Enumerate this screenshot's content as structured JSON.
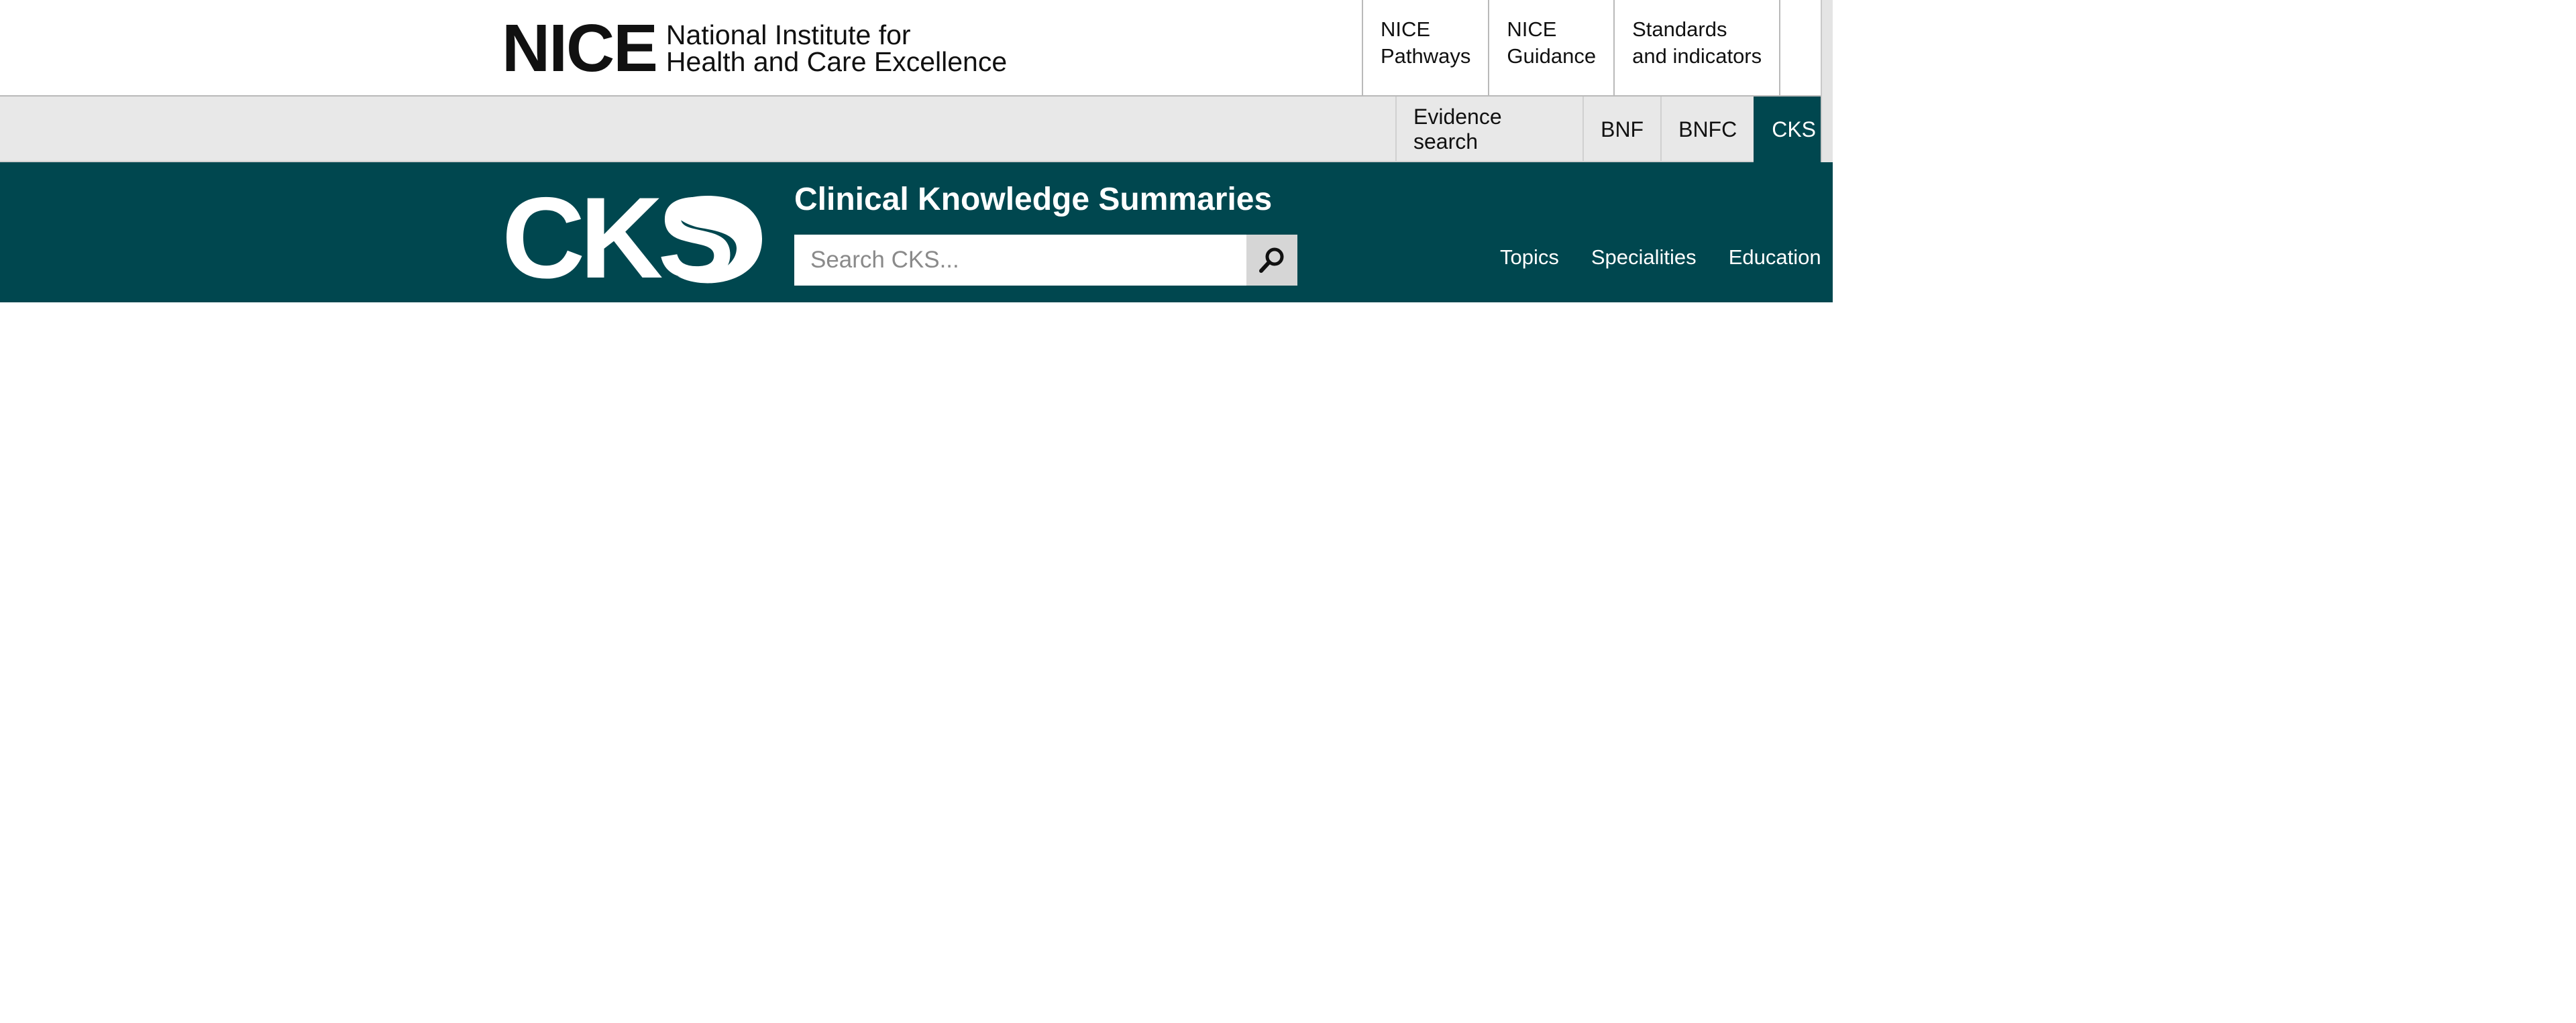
{
  "nice": {
    "logo_mark": "NICE",
    "logo_line1": "National Institute for",
    "logo_line2": "Health and Care Excellence"
  },
  "top_nav": [
    {
      "line1": "NICE",
      "line2": "Pathways"
    },
    {
      "line1": "NICE",
      "line2": "Guidance"
    },
    {
      "line1": "Standards",
      "line2": "and indicators"
    }
  ],
  "sub_nav": [
    {
      "label": "Evidence search"
    },
    {
      "label": "BNF"
    },
    {
      "label": "BNFC"
    },
    {
      "label": "CKS",
      "active": true
    }
  ],
  "cks": {
    "logo_text": "CKS",
    "title": "Clinical Knowledge Summaries",
    "search_placeholder": "Search CKS...",
    "search_value": "",
    "nav": [
      {
        "label": "Topics"
      },
      {
        "label": "Specialities"
      },
      {
        "label": "Education"
      }
    ]
  },
  "colors": {
    "teal": "#00474f",
    "grey_bar": "#e8e8e8",
    "text_dark": "#111111"
  }
}
